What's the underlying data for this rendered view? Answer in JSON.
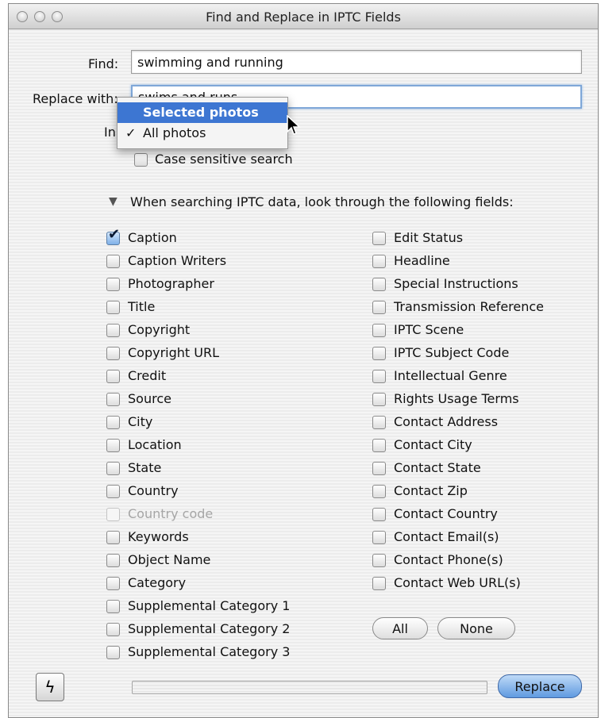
{
  "window": {
    "title": "Find and Replace in IPTC Fields"
  },
  "form": {
    "find_label": "Find:",
    "find_value": "swimming and running",
    "replace_label": "Replace with:",
    "replace_value": "swims and runs",
    "in_label": "In",
    "case_sensitive_label": "Case sensitive search",
    "case_sensitive_checked": false
  },
  "scope_menu": {
    "items": [
      {
        "label": "Selected photos",
        "highlighted": true,
        "checked": false
      },
      {
        "label": "All photos",
        "highlighted": false,
        "checked": true
      }
    ]
  },
  "fields_section": {
    "heading": "When searching IPTC data, look through the following fields:",
    "left": [
      {
        "label": "Caption",
        "checked": true
      },
      {
        "label": "Caption Writers",
        "checked": false
      },
      {
        "label": "Photographer",
        "checked": false
      },
      {
        "label": "Title",
        "checked": false
      },
      {
        "label": "Copyright",
        "checked": false
      },
      {
        "label": "Copyright URL",
        "checked": false
      },
      {
        "label": "Credit",
        "checked": false
      },
      {
        "label": "Source",
        "checked": false
      },
      {
        "label": "City",
        "checked": false
      },
      {
        "label": "Location",
        "checked": false
      },
      {
        "label": "State",
        "checked": false
      },
      {
        "label": "Country",
        "checked": false
      },
      {
        "label": "Country code",
        "checked": false,
        "disabled": true
      },
      {
        "label": "Keywords",
        "checked": false
      },
      {
        "label": "Object Name",
        "checked": false
      },
      {
        "label": "Category",
        "checked": false
      },
      {
        "label": "Supplemental Category 1",
        "checked": false
      },
      {
        "label": "Supplemental Category 2",
        "checked": false
      },
      {
        "label": "Supplemental Category 3",
        "checked": false
      }
    ],
    "right": [
      {
        "label": "Edit Status",
        "checked": false
      },
      {
        "label": "Headline",
        "checked": false
      },
      {
        "label": "Special Instructions",
        "checked": false
      },
      {
        "label": "Transmission Reference",
        "checked": false
      },
      {
        "label": "IPTC Scene",
        "checked": false
      },
      {
        "label": "IPTC Subject Code",
        "checked": false
      },
      {
        "label": "Intellectual Genre",
        "checked": false
      },
      {
        "label": "Rights Usage Terms",
        "checked": false
      },
      {
        "label": "Contact Address",
        "checked": false
      },
      {
        "label": "Contact City",
        "checked": false
      },
      {
        "label": "Contact State",
        "checked": false
      },
      {
        "label": "Contact Zip",
        "checked": false
      },
      {
        "label": "Contact Country",
        "checked": false
      },
      {
        "label": "Contact Email(s)",
        "checked": false
      },
      {
        "label": "Contact Phone(s)",
        "checked": false
      },
      {
        "label": "Contact Web URL(s)",
        "checked": false
      }
    ],
    "all_button": "All",
    "none_button": "None"
  },
  "footer": {
    "replace_button": "Replace",
    "progress": 0
  },
  "colors": {
    "menu_highlight": "#3d76d2",
    "default_button": "#5f9ae0",
    "focus_ring": "#7fa7d8"
  }
}
